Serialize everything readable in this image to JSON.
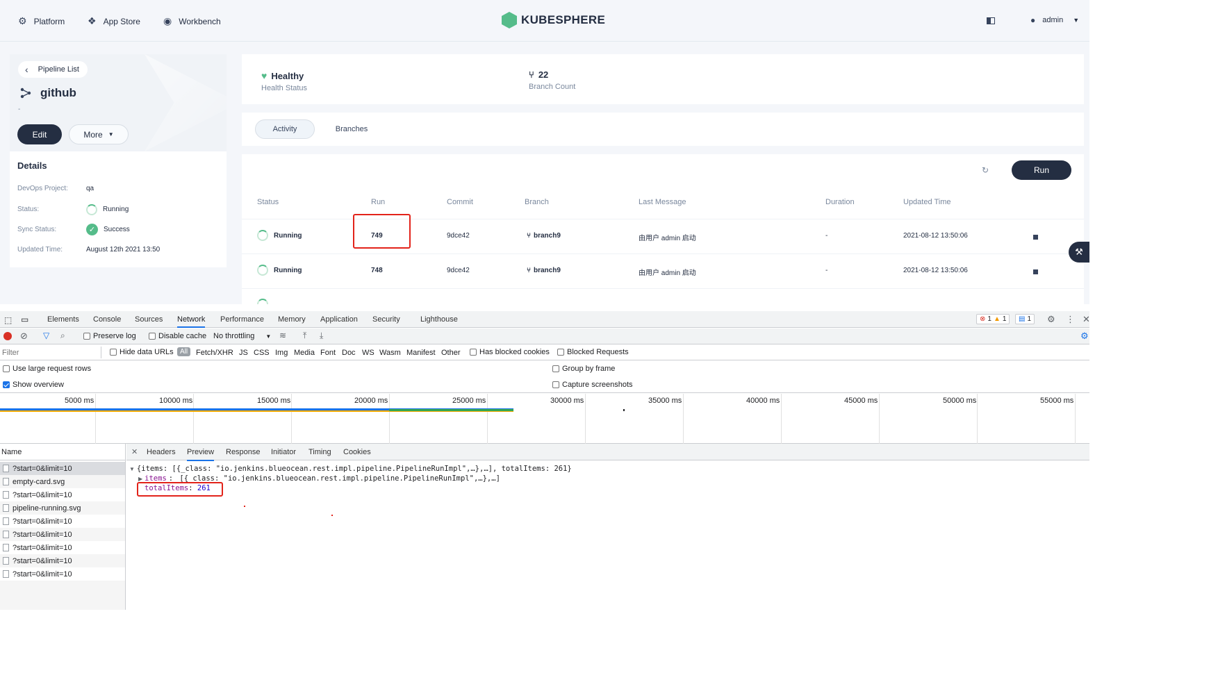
{
  "nav": {
    "platform": "Platform",
    "app_store": "App Store",
    "workbench": "Workbench",
    "logo": "KUBESPHERE",
    "user": "admin"
  },
  "pipeline": {
    "back_label": "Pipeline List",
    "name": "github",
    "desc": "-",
    "edit_label": "Edit",
    "more_label": "More"
  },
  "details": {
    "title": "Details",
    "rows": [
      {
        "label": "DevOps Project:",
        "value": "qa"
      },
      {
        "label": "Status:",
        "value": "Running"
      },
      {
        "label": "Sync Status:",
        "value": "Success"
      },
      {
        "label": "Updated Time:",
        "value": "August 12th 2021 13:50"
      }
    ]
  },
  "stats": {
    "health_value": "Healthy",
    "health_label": "Health Status",
    "branch_value": "22",
    "branch_label": "Branch Count"
  },
  "tabs": {
    "activity": "Activity",
    "branches": "Branches"
  },
  "run_label": "Run",
  "table": {
    "headers": [
      "Status",
      "Run",
      "Commit",
      "Branch",
      "Last Message",
      "Duration",
      "Updated Time"
    ],
    "rows": [
      {
        "status": "Running",
        "run": "749",
        "commit": "9dce42",
        "branch": "branch9",
        "message": "由用户 admin 启动",
        "duration": "-",
        "updated": "2021-08-12 13:50:06"
      },
      {
        "status": "Running",
        "run": "748",
        "commit": "9dce42",
        "branch": "branch9",
        "message": "由用户 admin 启动",
        "duration": "-",
        "updated": "2021-08-12 13:50:06"
      }
    ]
  },
  "devtools": {
    "tabs": [
      "Elements",
      "Console",
      "Sources",
      "Network",
      "Performance",
      "Memory",
      "Application",
      "Security",
      "Lighthouse"
    ],
    "active_tab": "Network",
    "badges": {
      "errors": "1",
      "warnings": "1",
      "messages": "1"
    },
    "toolbar": {
      "preserve_log": "Preserve log",
      "disable_cache": "Disable cache",
      "throttling": "No throttling"
    },
    "filter": {
      "placeholder": "Filter",
      "hide_data_urls": "Hide data URLs",
      "types": [
        "All",
        "Fetch/XHR",
        "JS",
        "CSS",
        "Img",
        "Media",
        "Font",
        "Doc",
        "WS",
        "Wasm",
        "Manifest",
        "Other"
      ],
      "has_blocked_cookies": "Has blocked cookies",
      "blocked_requests": "Blocked Requests"
    },
    "options": {
      "large_rows": "Use large request rows",
      "show_overview": "Show overview",
      "group_by_frame": "Group by frame",
      "capture_screenshots": "Capture screenshots"
    },
    "timeline_ticks": [
      "5000 ms",
      "10000 ms",
      "15000 ms",
      "20000 ms",
      "25000 ms",
      "30000 ms",
      "35000 ms",
      "40000 ms",
      "45000 ms",
      "50000 ms",
      "55000 ms"
    ],
    "names_header": "Name",
    "requests": [
      "?start=0&limit=10",
      "empty-card.svg",
      "?start=0&limit=10",
      "pipeline-running.svg",
      "?start=0&limit=10",
      "?start=0&limit=10",
      "?start=0&limit=10",
      "?start=0&limit=10",
      "?start=0&limit=10"
    ],
    "preview_tabs": [
      "Headers",
      "Preview",
      "Response",
      "Initiator",
      "Timing",
      "Cookies"
    ],
    "active_preview": "Preview",
    "preview": {
      "line1": "{items: [{_class: \"io.jenkins.blueocean.rest.impl.pipeline.PipelineRunImpl\",…},…], totalItems: 261}",
      "items_key": "items",
      "items_val": "[{_class: \"io.jenkins.blueocean.rest.impl.pipeline.PipelineRunImpl\",…},…]",
      "total_key": "totalItems",
      "total_val": "261"
    }
  }
}
